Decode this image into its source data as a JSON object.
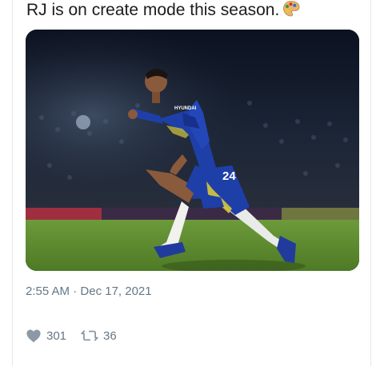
{
  "tweet": {
    "text": "RJ is on create mode this season.",
    "emoji": "artist-palette-icon",
    "media": {
      "jersey_number": "24",
      "sponsor": "HYUNDAI"
    },
    "time": "2:55 AM",
    "separator": " · ",
    "date": "Dec 17, 2021",
    "likes": "301",
    "retweets": "36"
  },
  "colors": {
    "text": "#1c1c1c",
    "muted": "#657786",
    "border": "#e1e8ed",
    "kit_blue": "#1f3fa8",
    "pitch_green": "#5d8a2c"
  }
}
